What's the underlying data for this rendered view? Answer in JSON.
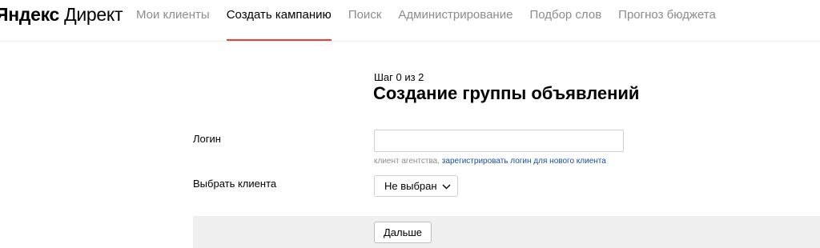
{
  "header": {
    "logo_part1": "Яндекс",
    "logo_part2": "Директ",
    "nav": [
      {
        "label": "Мои клиенты",
        "active": false
      },
      {
        "label": "Создать кампанию",
        "active": true
      },
      {
        "label": "Поиск",
        "active": false
      },
      {
        "label": "Администрирование",
        "active": false
      },
      {
        "label": "Подбор слов",
        "active": false
      },
      {
        "label": "Прогноз бюджета",
        "active": false
      }
    ],
    "active_indicator_color": "#ee3e2c"
  },
  "main": {
    "step": "Шаг 0 из 2",
    "title": "Создание группы объявлений",
    "login_label": "Логин",
    "login_value": "",
    "hint_text": "клиент агентства,",
    "hint_link": "зарегистрировать логин для нового клиента",
    "client_label": "Выбрать клиента",
    "client_select_value": "Не выбран",
    "next_button": "Дальше"
  },
  "colors": {
    "link": "#1a4b9e",
    "muted": "#8c8c8c",
    "footer_bg": "#efefef"
  }
}
